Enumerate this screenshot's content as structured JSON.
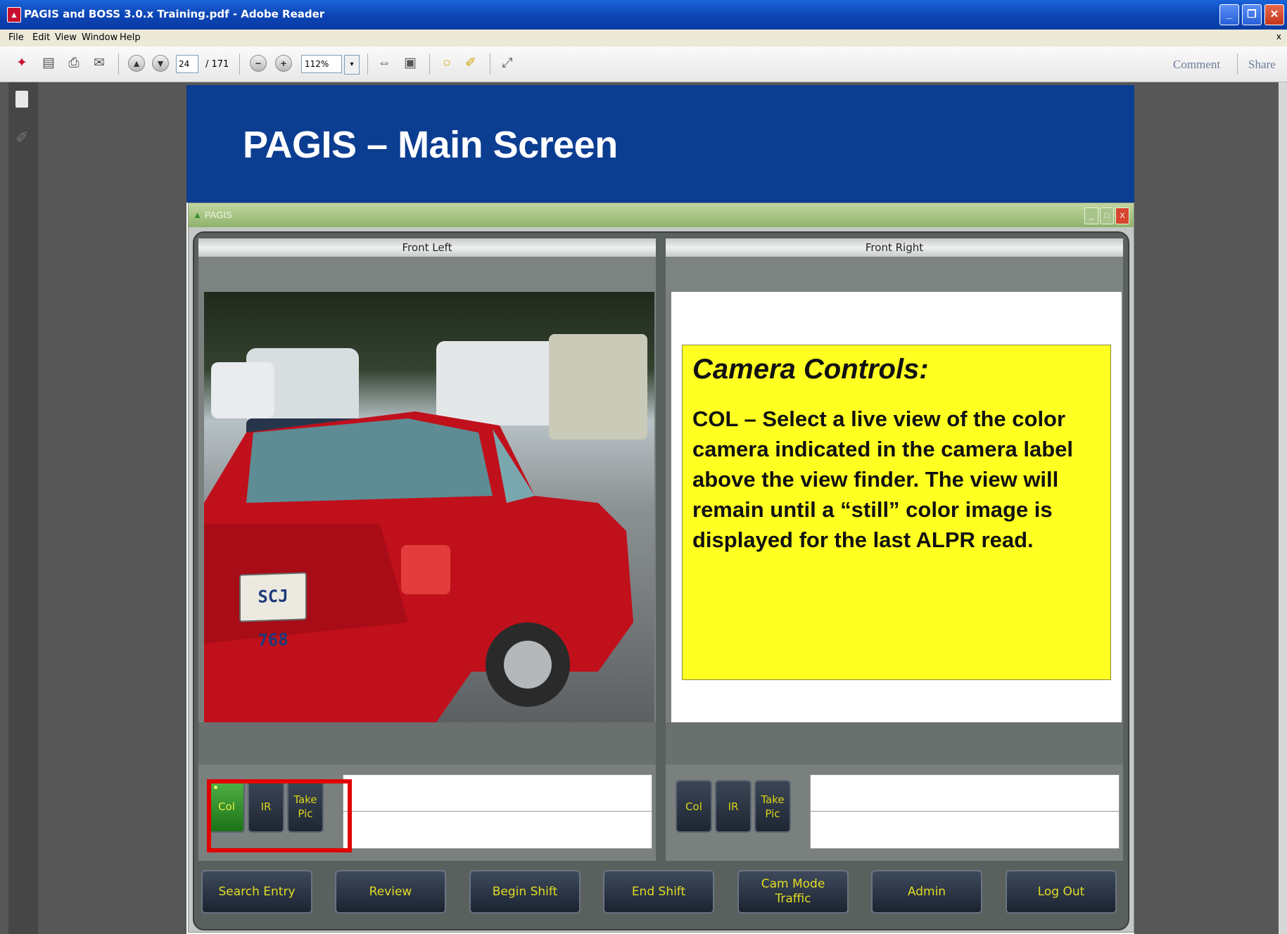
{
  "window": {
    "title": "PAGIS and BOSS 3.0.x Training.pdf - Adobe Reader",
    "minimize_glyph": "_",
    "restore_glyph": "❐",
    "close_glyph": "✕"
  },
  "menu": {
    "items": [
      "File",
      "Edit",
      "View",
      "Window",
      "Help"
    ],
    "close_glyph": "x"
  },
  "toolbar": {
    "page_number": "24",
    "page_total": "/ 171",
    "zoom": "112%",
    "zoom_drop_glyph": "▾",
    "comment_label": "Comment",
    "share_label": "Share",
    "icons": {
      "create": "✦",
      "save": "▤",
      "print": "⎙",
      "email": "✉",
      "prev_page": "▲",
      "next_page": "▼",
      "zoom_out": "−",
      "zoom_in": "+",
      "fit_width": "⇔",
      "fit_page": "▣",
      "comment": "○",
      "markup": "✐",
      "expand": "⤢",
      "attachment": "✐"
    }
  },
  "slide": {
    "title": "PAGIS – Main Screen",
    "app_window_title": "PAGIS",
    "app_window_buttons": [
      "_",
      "□",
      "X"
    ],
    "colors": {
      "header_blue": "#0b3d91",
      "callout_yellow": "#ffff22",
      "highlight_red": "#e00000",
      "button_text": "#e2dc24",
      "active_green": "#2e8f27"
    }
  },
  "camera_left": {
    "label": "Front Left",
    "plate_text": "SCJ 768",
    "buttons": [
      {
        "label": "Col",
        "active": true
      },
      {
        "label": "IR",
        "active": false
      },
      {
        "label": "Take Pic",
        "active": false
      }
    ]
  },
  "camera_right": {
    "label": "Front Right",
    "buttons": [
      {
        "label": "Col",
        "active": false
      },
      {
        "label": "IR",
        "active": false
      },
      {
        "label": "Take Pic",
        "active": false
      }
    ]
  },
  "callout": {
    "title": "Camera Controls:",
    "body": "COL – Select a live view of the color camera indicated in the camera label above the view finder.  The view will remain until a “still” color image is displayed for the last ALPR read."
  },
  "bottom_nav": [
    {
      "label": "Search Entry"
    },
    {
      "label": "Review"
    },
    {
      "label": "Begin Shift"
    },
    {
      "label": "End Shift"
    },
    {
      "label": "Cam Mode",
      "sub": "Traffic"
    },
    {
      "label": "Admin"
    },
    {
      "label": "Log Out"
    }
  ]
}
